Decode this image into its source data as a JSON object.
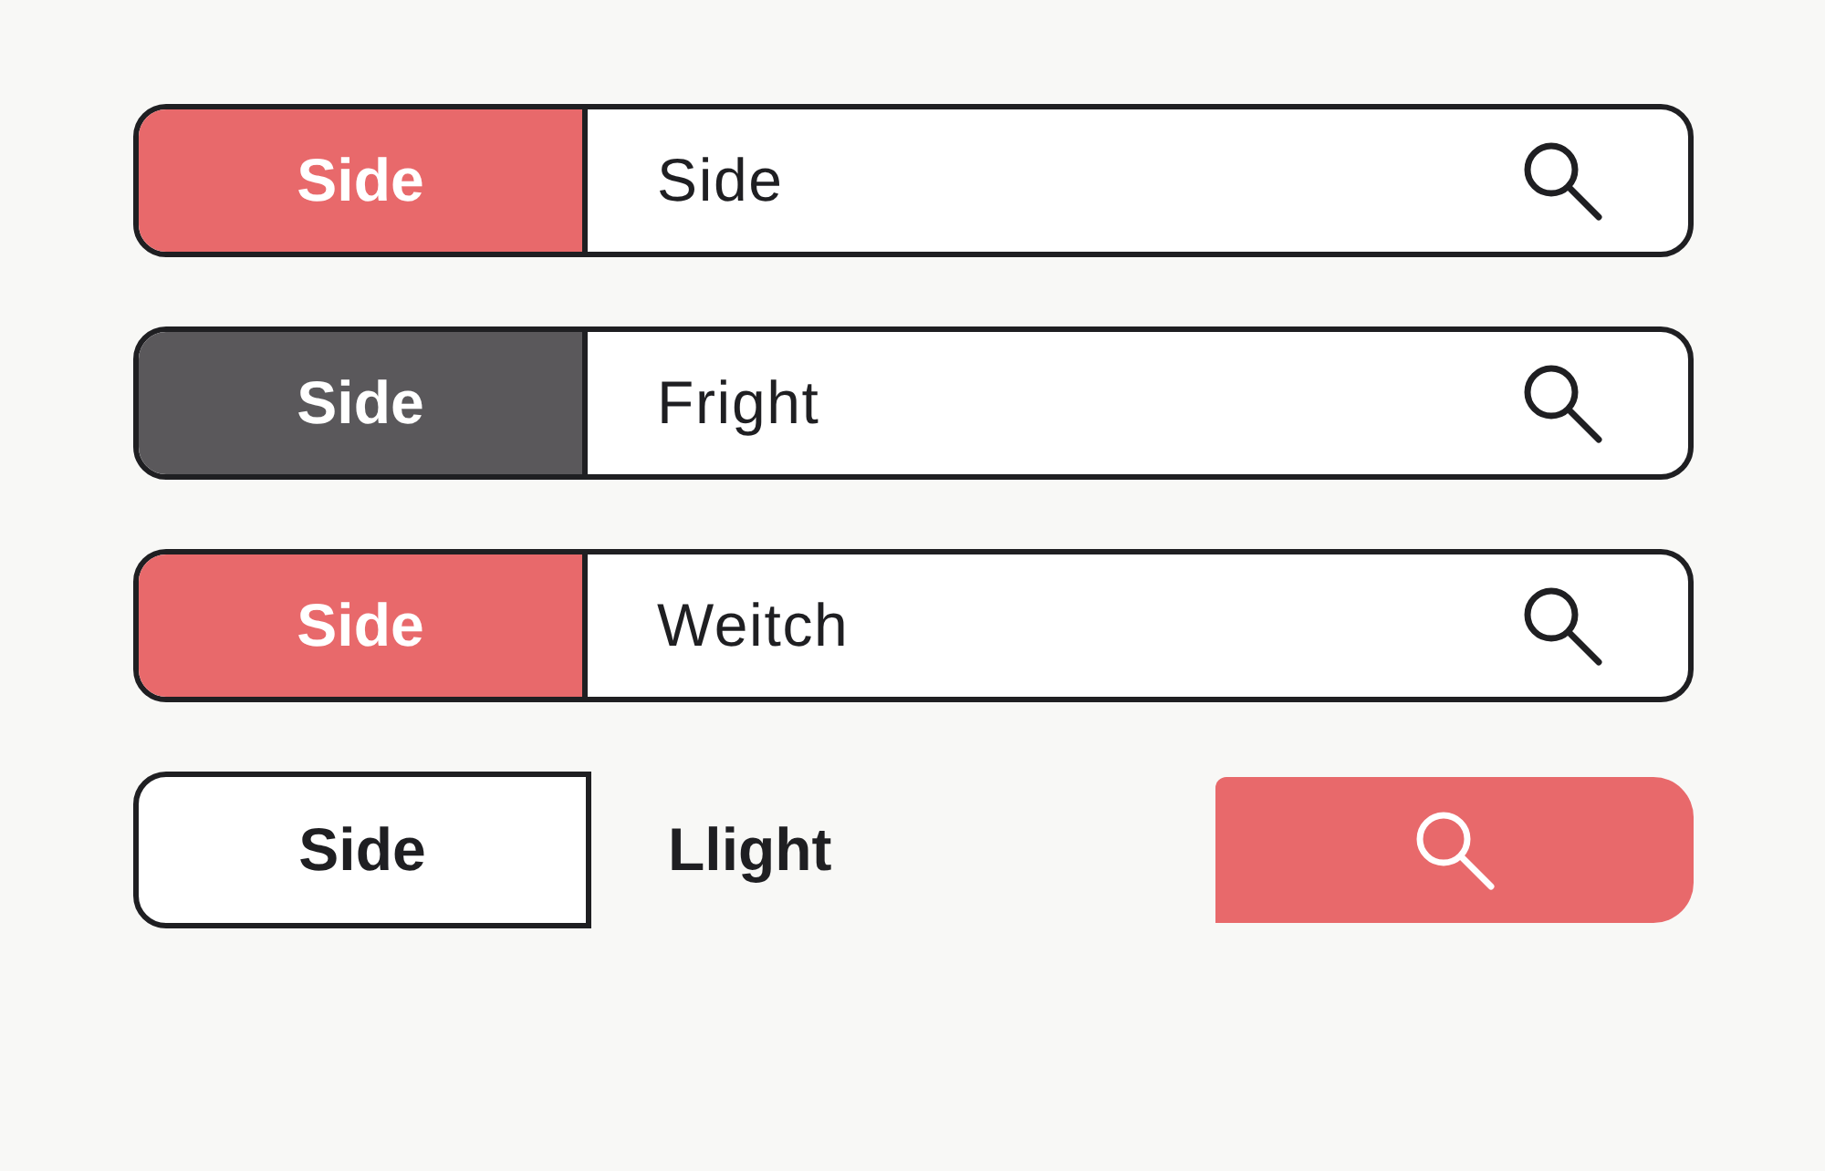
{
  "search_bars": [
    {
      "kind": "joined",
      "label": "Side",
      "color": "#e8696b",
      "query": "Side"
    },
    {
      "kind": "joined",
      "label": "Side",
      "color": "#5a585b",
      "query": "Fright"
    },
    {
      "kind": "joined",
      "label": "Side",
      "color": "#e8696b",
      "query": "Weitch"
    },
    {
      "kind": "split",
      "label": "Side",
      "query": "Llight",
      "color": "#e8696b"
    }
  ]
}
